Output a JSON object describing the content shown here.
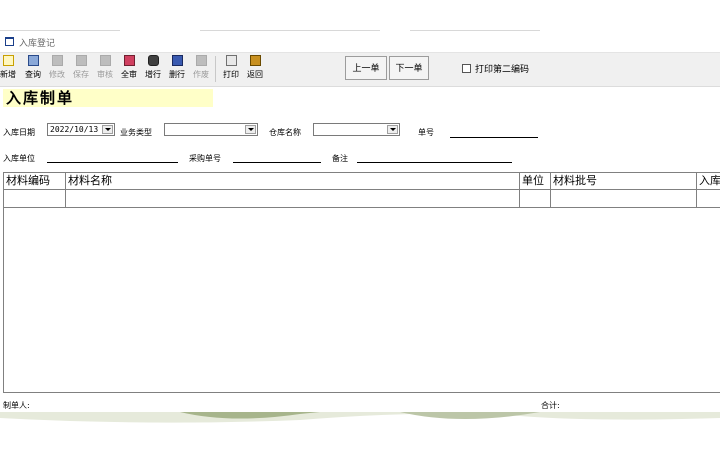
{
  "window": {
    "title": "入库登记"
  },
  "toolbar": {
    "buttons": [
      {
        "label": "新增",
        "enabled": true
      },
      {
        "label": "查询",
        "enabled": true
      },
      {
        "label": "修改",
        "enabled": false
      },
      {
        "label": "保存",
        "enabled": false
      },
      {
        "label": "审核",
        "enabled": false
      },
      {
        "label": "全审",
        "enabled": true
      },
      {
        "label": "增行",
        "enabled": true
      },
      {
        "label": "删行",
        "enabled": true
      },
      {
        "label": "作废",
        "enabled": false
      },
      {
        "label": "打印",
        "enabled": true
      },
      {
        "label": "返回",
        "enabled": true
      }
    ],
    "prev_label": "上一单",
    "next_label": "下一单",
    "print_second_barcode_label": "打印第二编码",
    "print_second_barcode_checked": false
  },
  "form": {
    "heading": "入库制单",
    "date_label": "入库日期",
    "date_value": "2022/10/13",
    "business_type_label": "业务类型",
    "business_type_value": "",
    "warehouse_label": "仓库名称",
    "warehouse_value": "",
    "doc_no_label": "单号",
    "doc_no_value": "",
    "unit_label": "入库单位",
    "unit_value": "",
    "purchase_no_label": "采购单号",
    "purchase_no_value": "",
    "remark_label": "备注",
    "remark_value": ""
  },
  "grid": {
    "columns": [
      "材料编码",
      "材料名称",
      "单位",
      "材料批号",
      "入库"
    ],
    "rows": [
      [
        "",
        "",
        "",
        "",
        ""
      ]
    ]
  },
  "footer": {
    "creator_label": "制单人:",
    "creator_value": "",
    "total_label": "合计:",
    "total_value": ""
  },
  "colors": {
    "heading_bg": "#ffffc8",
    "toolbar_bg": "#f0f0f0",
    "grid_line": "#808080",
    "title_icon": "#1b3f8a"
  }
}
